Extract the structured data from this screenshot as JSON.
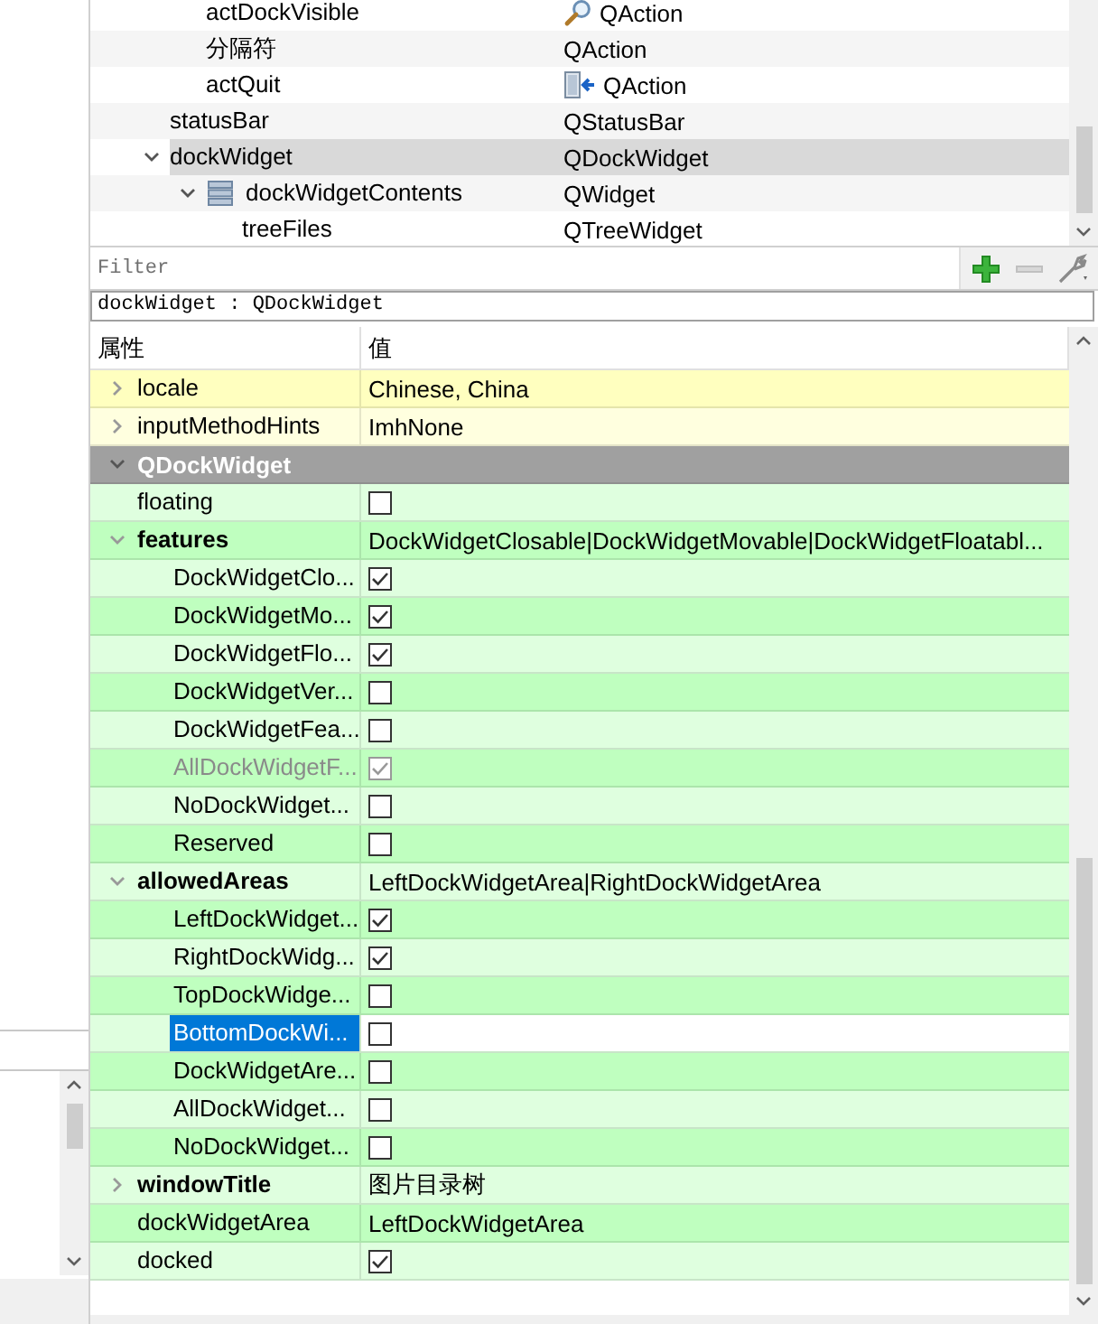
{
  "object_tree": {
    "continued_children": [
      {
        "name": "actDockVisible",
        "class": "QAction",
        "kind": "findaction",
        "selected": false
      },
      {
        "name": "分隔符",
        "class": "QAction",
        "selected": false
      },
      {
        "name": "actQuit",
        "class": "QAction",
        "kind": "quitaction",
        "selected": false
      }
    ],
    "items": [
      {
        "name": "statusBar",
        "class": "QStatusBar",
        "selected": false
      },
      {
        "name": "dockWidget",
        "class": "QDockWidget",
        "selected": true,
        "expanded": true,
        "children": [
          {
            "name": "dockWidgetContents",
            "class": "QWidget",
            "kind": "layout",
            "selected": false,
            "expanded": true,
            "children": [
              {
                "name": "treeFiles",
                "class": "QTreeWidget",
                "selected": false
              }
            ]
          }
        ]
      }
    ]
  },
  "filter": {
    "placeholder": "Filter"
  },
  "property_path": "dockWidget : QDockWidget",
  "property_editor": {
    "columns": [
      "属性",
      "值"
    ],
    "groups": [
      {
        "color": "#ffffbf",
        "properties": [
          {
            "name": "locale",
            "kind": "text",
            "value": "Chinese, China",
            "expanded": false,
            "modified": false,
            "disabled": false,
            "selected": false
          },
          {
            "name": "inputMethodHints",
            "kind": "text",
            "value": "ImhNone",
            "expanded": false,
            "modified": false,
            "disabled": false,
            "selected": false
          }
        ]
      },
      {
        "title": "QDockWidget",
        "expanded": true,
        "color": "#bfffbf",
        "properties": [
          {
            "name": "floating",
            "kind": "bool",
            "checked": false,
            "modified": false,
            "disabled": false,
            "selected": false
          },
          {
            "name": "features",
            "kind": "text",
            "value": "DockWidgetClosable|DockWidgetMovable|DockWidgetFloatabl...",
            "expanded": true,
            "modified": true,
            "disabled": false,
            "selected": false,
            "children": [
              {
                "name": "DockWidgetClo...",
                "kind": "bool",
                "checked": true,
                "modified": false,
                "disabled": false,
                "selected": false
              },
              {
                "name": "DockWidgetMo...",
                "kind": "bool",
                "checked": true,
                "modified": false,
                "disabled": false,
                "selected": false
              },
              {
                "name": "DockWidgetFlo...",
                "kind": "bool",
                "checked": true,
                "modified": false,
                "disabled": false,
                "selected": false
              },
              {
                "name": "DockWidgetVer...",
                "kind": "bool",
                "checked": false,
                "modified": false,
                "disabled": false,
                "selected": false
              },
              {
                "name": "DockWidgetFea...",
                "kind": "bool",
                "checked": false,
                "modified": false,
                "disabled": false,
                "selected": false
              },
              {
                "name": "AllDockWidgetF...",
                "kind": "bool",
                "checked": true,
                "modified": false,
                "disabled": true,
                "selected": false
              },
              {
                "name": "NoDockWidget...",
                "kind": "bool",
                "checked": false,
                "modified": false,
                "disabled": false,
                "selected": false
              },
              {
                "name": "Reserved",
                "kind": "bool",
                "checked": false,
                "modified": false,
                "disabled": false,
                "selected": false
              }
            ]
          },
          {
            "name": "allowedAreas",
            "kind": "text",
            "value": "LeftDockWidgetArea|RightDockWidgetArea",
            "expanded": true,
            "modified": true,
            "disabled": false,
            "selected": false,
            "children": [
              {
                "name": "LeftDockWidget...",
                "kind": "bool",
                "checked": true,
                "modified": false,
                "disabled": false,
                "selected": false
              },
              {
                "name": "RightDockWidg...",
                "kind": "bool",
                "checked": true,
                "modified": false,
                "disabled": false,
                "selected": false
              },
              {
                "name": "TopDockWidge...",
                "kind": "bool",
                "checked": false,
                "modified": false,
                "disabled": false,
                "selected": false
              },
              {
                "name": "BottomDockWi...",
                "kind": "bool",
                "checked": false,
                "modified": false,
                "disabled": false,
                "selected": true
              },
              {
                "name": "DockWidgetAre...",
                "kind": "bool",
                "checked": false,
                "modified": false,
                "disabled": false,
                "selected": false
              },
              {
                "name": "AllDockWidget...",
                "kind": "bool",
                "checked": false,
                "modified": false,
                "disabled": false,
                "selected": false
              },
              {
                "name": "NoDockWidget...",
                "kind": "bool",
                "checked": false,
                "modified": false,
                "disabled": false,
                "selected": false
              }
            ]
          },
          {
            "name": "windowTitle",
            "kind": "text",
            "value": "图片目录树",
            "expanded": false,
            "modified": true,
            "disabled": false,
            "selected": false
          },
          {
            "name": "dockWidgetArea",
            "kind": "text",
            "value": "LeftDockWidgetArea",
            "modified": false,
            "disabled": false,
            "selected": false
          },
          {
            "name": "docked",
            "kind": "bool",
            "checked": true,
            "modified": false,
            "disabled": false,
            "selected": false
          }
        ]
      }
    ]
  }
}
